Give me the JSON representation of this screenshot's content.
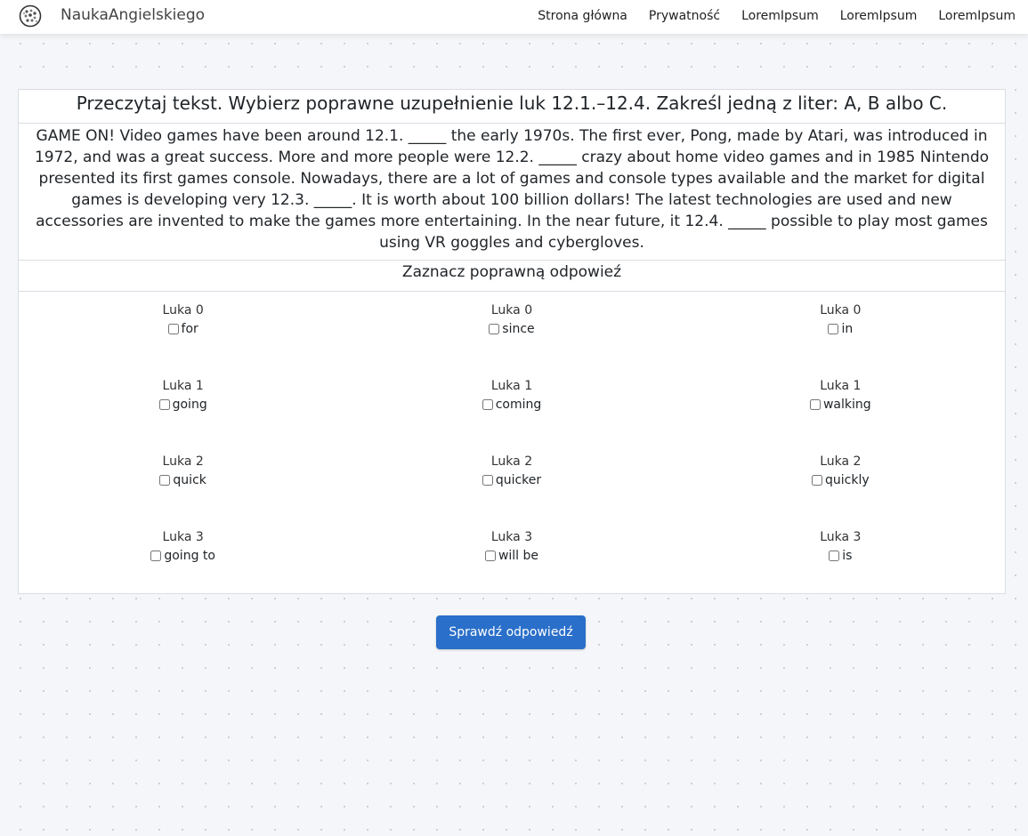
{
  "nav": {
    "brand": "NaukaAngielskiego",
    "links": [
      "Strona główna",
      "Prywatność",
      "LoremIpsum",
      "LoremIpsum",
      "LoremIpsum"
    ]
  },
  "exercise": {
    "instruction": "Przeczytaj tekst. Wybierz poprawne uzupełnienie luk 12.1.–12.4. Zakreśl jedną z liter: A, B albo C.",
    "passage": "GAME ON! Video games have been around 12.1. _____ the early 1970s. The first ever, Pong, made by Atari, was introduced in 1972, and was a great success. More and more people were 12.2. _____ crazy about home video games and in 1985 Nintendo presented its first games console. Nowadays, there are a lot of games and console types available and the market for digital games is developing very 12.3. _____. It is worth about 100 billion dollars! The latest technologies are used and new accessories are invented to make the games more entertaining. In the near future, it 12.4. _____ possible to play most games using VR goggles and cybergloves.",
    "prompt": "Zaznacz poprawną odpowieź",
    "gaps": [
      {
        "label": "Luka 0",
        "options": [
          "for",
          "since",
          "in"
        ]
      },
      {
        "label": "Luka 1",
        "options": [
          "going",
          "coming",
          "walking"
        ]
      },
      {
        "label": "Luka 2",
        "options": [
          "quick",
          "quicker",
          "quickly"
        ]
      },
      {
        "label": "Luka 3",
        "options": [
          "going to",
          "will be",
          "is"
        ]
      }
    ],
    "submit_label": "Sprawdź odpowiedź"
  },
  "colors": {
    "primary": "#2a6fc9",
    "background": "#f4f6f9"
  }
}
